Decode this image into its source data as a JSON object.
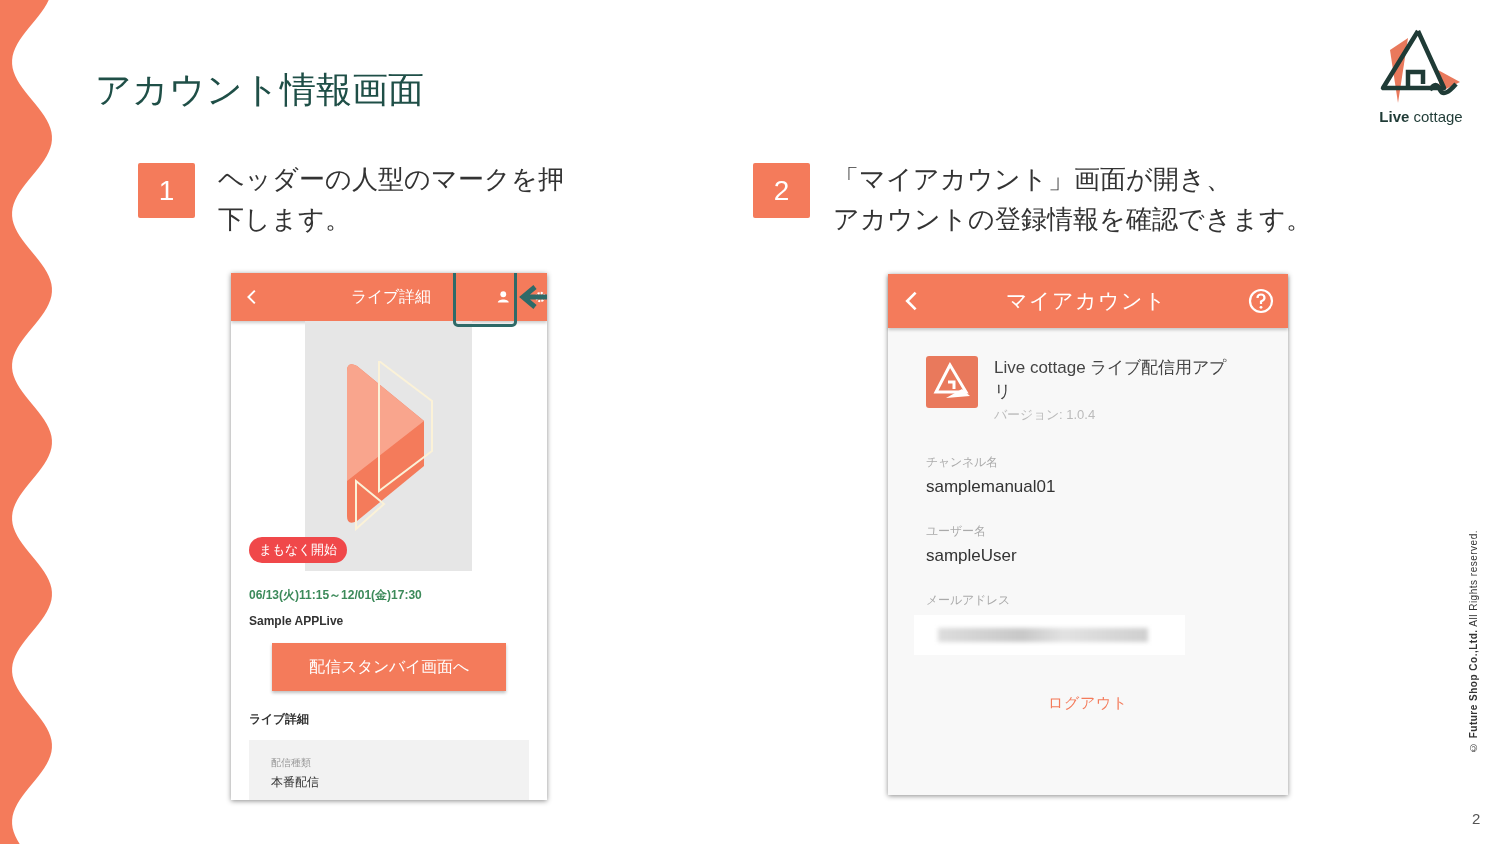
{
  "title": "アカウント情報画面",
  "logo": {
    "text": "**Live** cottage"
  },
  "steps": [
    {
      "number": "1",
      "lines": [
        "ヘッダーの人型のマークを押",
        "下します。"
      ]
    },
    {
      "number": "2",
      "lines": [
        "「マイアカウント」画面が開き、",
        "アカウントの登録情報を確認できます。"
      ]
    }
  ],
  "screen_1": {
    "header_title": "ライブ詳細",
    "status_badge": "まもなく開始",
    "schedule": "06/13(火)11:15～12/01(金)17:30",
    "live_name": "Sample APPLive",
    "standby_button": "配信スタンバイ画面へ",
    "section_title": "ライブ詳細",
    "details": [
      {
        "label": "配信種類",
        "value": "本番配信"
      }
    ]
  },
  "screen_2": {
    "header_title": "マイアカウント",
    "app_name": "Live cottage ライブ配信用アプリ",
    "version": "バージョン: 1.0.4",
    "fields": [
      {
        "kind": "text",
        "label": "チャンネル名",
        "value": "samplemanual01"
      },
      {
        "kind": "text",
        "label": "ユーザー名",
        "value": "sampleUser"
      },
      {
        "kind": "hidden",
        "label": "メールアドレス"
      }
    ],
    "logout": "ログアウト"
  },
  "copyright": "© **Future Shop Co.,Ltd.** All Rights reserved.",
  "page_number": "2"
}
